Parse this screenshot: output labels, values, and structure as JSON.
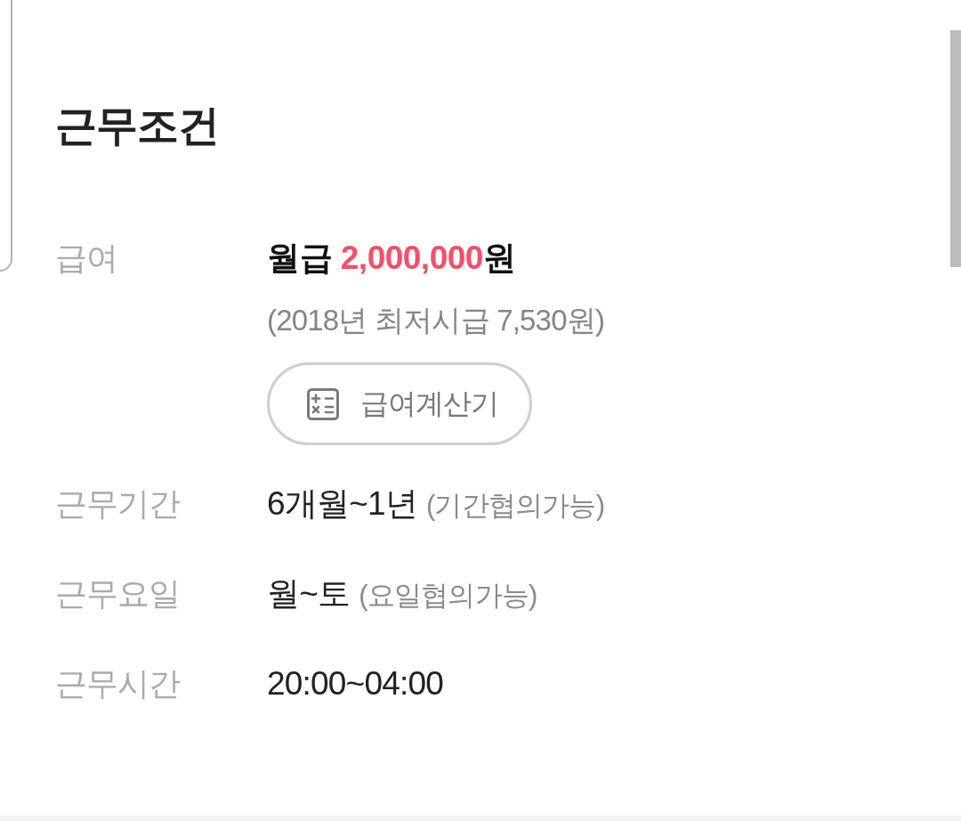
{
  "section": {
    "title": "근무조건"
  },
  "conditions": [
    {
      "kind": "salary",
      "label": "급여",
      "pay_type": "월급",
      "amount": "2,000,000",
      "unit": "원",
      "note": "(2018년 최저시급 7,530원)",
      "button": "급여계산기"
    },
    {
      "kind": "text",
      "label": "근무기간",
      "value": "6개월~1년",
      "note": "(기간협의가능)"
    },
    {
      "kind": "text",
      "label": "근무요일",
      "value": "월~토",
      "note": "(요일협의가능)"
    },
    {
      "kind": "text",
      "label": "근무시간",
      "value": "20:00~04:00"
    }
  ]
}
